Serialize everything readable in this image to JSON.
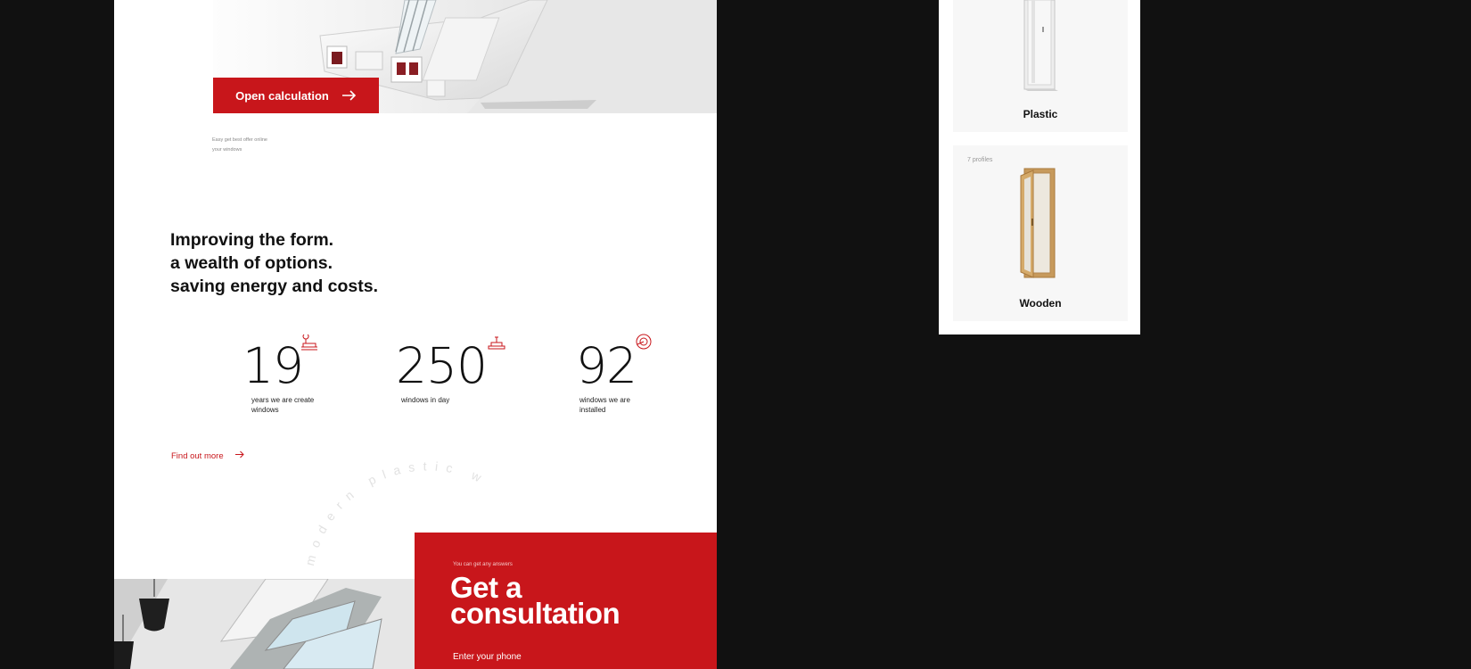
{
  "hero": {
    "open_calc_label": "Open calculation",
    "caption_line1": "Easy get best offer online",
    "caption_line2": "your windows"
  },
  "about": {
    "headline_line1": "Improving the form.",
    "headline_line2": "a wealth of options.",
    "headline_line3": "saving energy and costs.",
    "stats": [
      {
        "value": "19",
        "label_line1": "years we are create",
        "label_line2": "windows",
        "icon": "window-sill-icon"
      },
      {
        "value": "250",
        "label_line1": "windows in day",
        "label_line2": "",
        "icon": "window-profile-icon"
      },
      {
        "value": "92",
        "label_line1": "windows we are",
        "label_line2": "installed",
        "icon": "seal-roll-icon"
      }
    ],
    "find_more_label": "Find out more",
    "circular_text": "modern plastic w"
  },
  "consultation": {
    "overline": "You can get any answers",
    "title_line1": "Get a",
    "title_line2": "consultation",
    "phone_placeholder": "Enter your phone"
  },
  "side_panel": {
    "cards": [
      {
        "name": "Plastic",
        "meta": ""
      },
      {
        "name": "Wooden",
        "meta": "7 profiles"
      }
    ]
  },
  "colors": {
    "accent": "#c8161b",
    "background": "#111111",
    "surface": "#ffffff",
    "card": "#f7f7f7"
  }
}
